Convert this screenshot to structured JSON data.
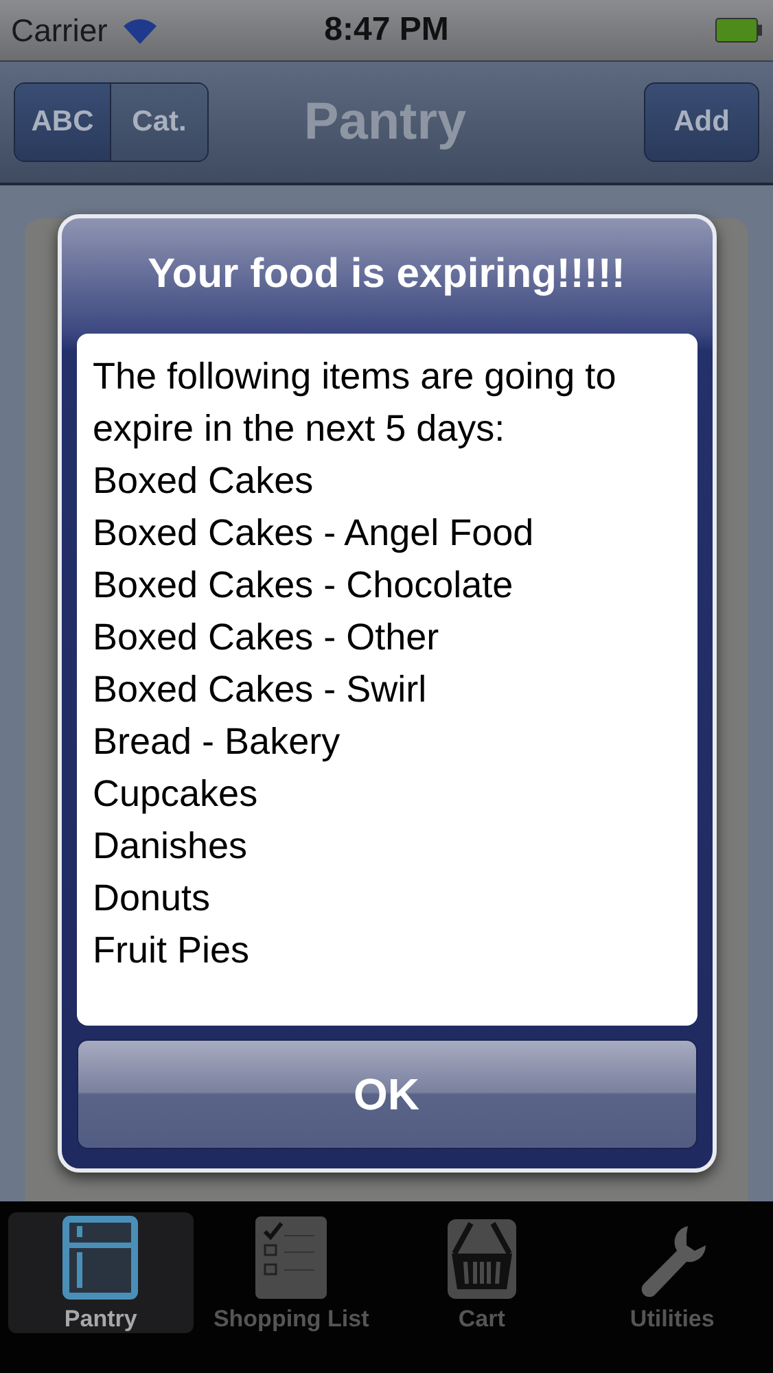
{
  "status_bar": {
    "carrier": "Carrier",
    "time": "8:47 PM"
  },
  "nav_bar": {
    "title": "Pantry",
    "segments": [
      {
        "label": "ABC",
        "selected": true
      },
      {
        "label": "Cat.",
        "selected": false
      }
    ],
    "action": "Add"
  },
  "alert": {
    "title": "Your food is expiring!!!!!",
    "message": "The following items are going to expire in the next 5 days:",
    "items": [
      "Boxed Cakes",
      "Boxed Cakes - Angel Food",
      "Boxed Cakes - Chocolate",
      "Boxed Cakes - Other",
      "Boxed Cakes - Swirl",
      "Bread - Bakery",
      "Cupcakes",
      "Danishes",
      "Donuts",
      "Fruit Pies"
    ],
    "button": "OK"
  },
  "tab_bar": [
    {
      "label": "Pantry",
      "kind": "pantry",
      "selected": true
    },
    {
      "label": "Shopping List",
      "kind": "list",
      "selected": false
    },
    {
      "label": "Cart",
      "kind": "cart",
      "selected": false
    },
    {
      "label": "Utilities",
      "kind": "wrench",
      "selected": false
    }
  ]
}
